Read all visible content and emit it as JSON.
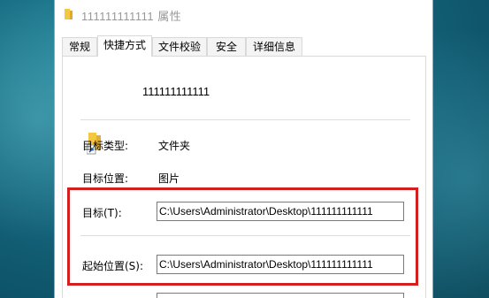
{
  "window": {
    "title": "111111111111 属性"
  },
  "tabs": [
    {
      "label": "常规"
    },
    {
      "label": "快捷方式"
    },
    {
      "label": "文件校验"
    },
    {
      "label": "安全"
    },
    {
      "label": "详细信息"
    }
  ],
  "shortcut": {
    "name": "111111111111"
  },
  "properties": {
    "target_type_label": "目标类型:",
    "target_type_value": "文件夹",
    "target_location_label": "目标位置:",
    "target_location_value": "图片",
    "target_label": "目标(T):",
    "target_value": "C:\\Users\\Administrator\\Desktop\\111111111111",
    "start_in_label": "起始位置(S):",
    "start_in_value": "C:\\Users\\Administrator\\Desktop\\111111111111"
  },
  "colors": {
    "highlight": "#d51f1f",
    "folder": "#f5c640"
  }
}
